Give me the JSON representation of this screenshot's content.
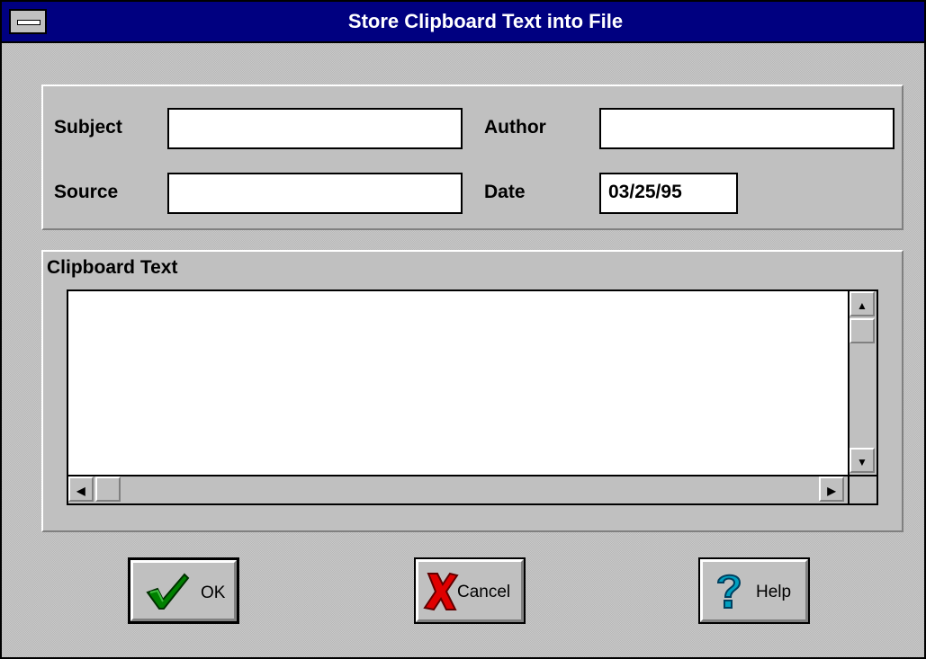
{
  "window": {
    "title": "Store Clipboard Text into File"
  },
  "fields": {
    "subject": {
      "label": "Subject",
      "value": ""
    },
    "author": {
      "label": "Author",
      "value": ""
    },
    "source": {
      "label": "Source",
      "value": ""
    },
    "date": {
      "label": "Date",
      "value": "03/25/95"
    }
  },
  "clipboard": {
    "label": "Clipboard Text",
    "value": ""
  },
  "buttons": {
    "ok": {
      "label": "OK",
      "icon": "check-icon"
    },
    "cancel": {
      "label": "Cancel",
      "icon": "x-icon"
    },
    "help": {
      "label": "Help",
      "icon": "question-icon"
    }
  },
  "scroll_glyphs": {
    "up": "▲",
    "down": "▼",
    "left": "◀",
    "right": "▶"
  }
}
